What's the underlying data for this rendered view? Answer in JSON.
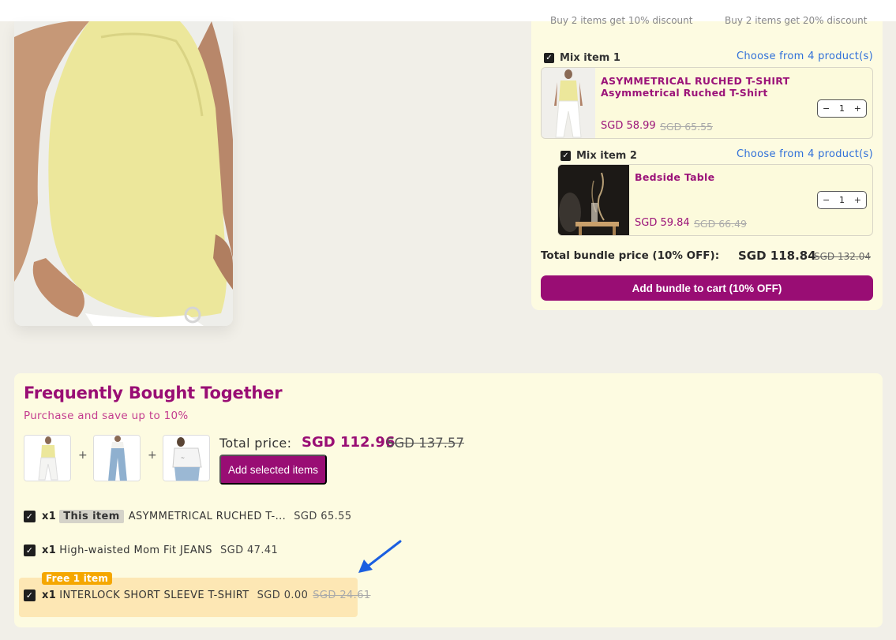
{
  "bundle": {
    "tier1_text": "Buy 2 items get 10% discount",
    "tier2_text": "Buy 2 items get 20% discount",
    "items": [
      {
        "mix_label": "Mix item 1",
        "choose_text": "Choose from 4 product(s)",
        "title_line1": "ASYMMETRICAL RUCHED T-SHIRT",
        "title_line2": "Asymmetrical Ruched T-Shirt",
        "price": "SGD 58.99",
        "old_price": "SGD 65.55",
        "qty": "1"
      },
      {
        "mix_label": "Mix item 2",
        "choose_text": "Choose from 4 product(s)",
        "title_line1": "Bedside Table",
        "price": "SGD 59.84",
        "old_price": "SGD 66.49",
        "qty": "1"
      }
    ],
    "total_label": "Total bundle price (10% OFF):",
    "total_price": "SGD 118.84",
    "total_old_price": "SGD 132.04",
    "add_button": "Add bundle to cart (10% OFF)"
  },
  "fbt": {
    "title": "Frequently Bought Together",
    "subtitle": "Purchase and save up to 10%",
    "total_label": "Total price:",
    "total_price": "SGD 112.96",
    "total_old_price": "SGD 137.57",
    "add_button": "Add selected items",
    "plus": "+",
    "items": [
      {
        "qty": "x1",
        "badge": "This item",
        "name": "ASYMMETRICAL RUCHED T-...",
        "price": "SGD 65.55"
      },
      {
        "qty": "x1",
        "name": "High-waisted Mom Fit JEANS",
        "price": "SGD 47.41"
      },
      {
        "qty": "x1",
        "name": "INTERLOCK SHORT SLEEVE T-SHIRT",
        "price": "SGD 0.00",
        "old_price": "SGD 24.61",
        "free_badge": "Free 1 item"
      }
    ]
  },
  "colors": {
    "brand": "#990d74",
    "link": "#2f6fd9",
    "panel": "#fdfbe1",
    "free_badge": "#f5a700",
    "free_row": "#fde7b4",
    "arrow": "#1b5fe0"
  }
}
